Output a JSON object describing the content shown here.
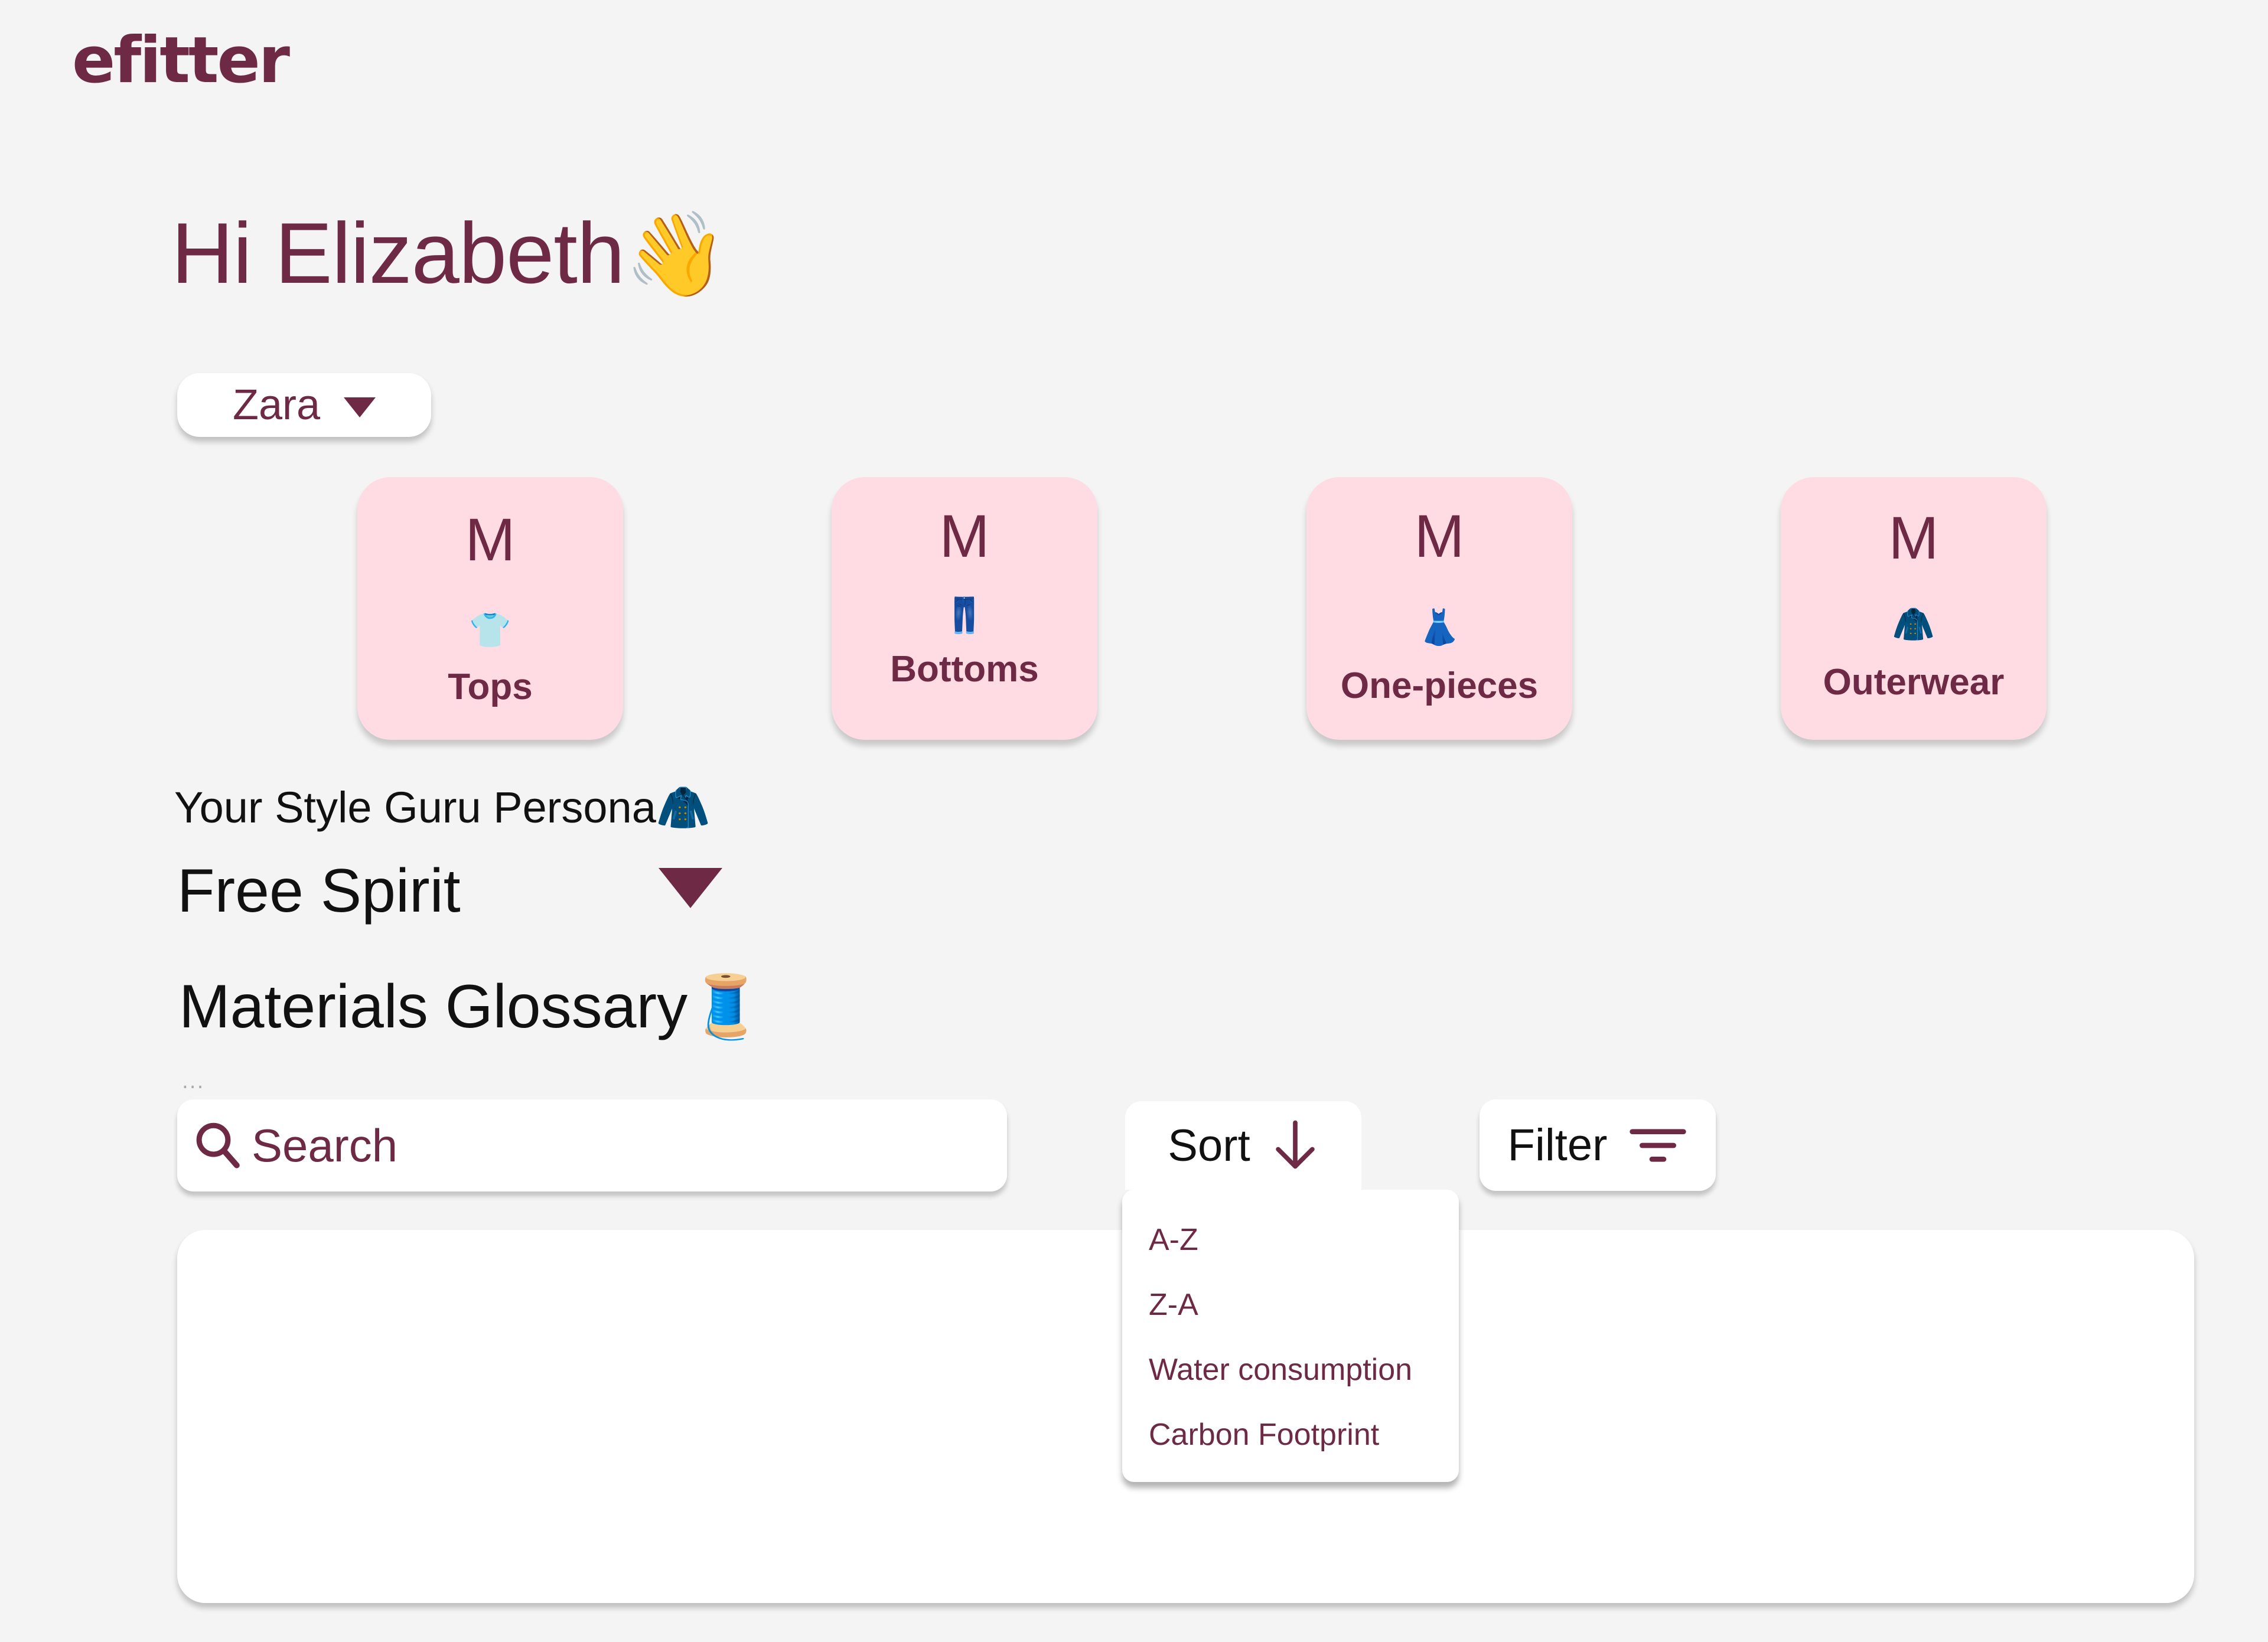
{
  "app": {
    "logo": "efitter"
  },
  "greeting": {
    "text": "Hi Elizabeth",
    "emoji": "👋"
  },
  "brand_selector": {
    "value": "Zara",
    "icon": "caret-down-icon"
  },
  "size_cards": [
    {
      "size": "M",
      "emoji": "👕",
      "icon": "shirt-icon",
      "label": "Tops"
    },
    {
      "size": "M",
      "emoji": "👖",
      "icon": "jeans-icon",
      "label": "Bottoms"
    },
    {
      "size": "M",
      "emoji": "👗",
      "icon": "dress-icon",
      "label": "One-pieces"
    },
    {
      "size": "M",
      "emoji": "🧥",
      "icon": "coat-icon",
      "label": "Outerwear"
    }
  ],
  "persona": {
    "label": "Your Style Guru Persona",
    "label_emoji": "🧥",
    "value": "Free Spirit",
    "icon": "caret-down-icon"
  },
  "glossary": {
    "title": "Materials Glossary",
    "title_emoji": "🧵",
    "more": "...",
    "search": {
      "placeholder": "Search",
      "value": "",
      "icon": "search-icon"
    },
    "sort": {
      "label": "Sort",
      "icon": "arrow-down-icon"
    },
    "filter": {
      "label": "Filter",
      "icon": "filter-lines-icon"
    },
    "sort_options": [
      "A-Z",
      "Z-A",
      "Water consumption",
      "Carbon Footprint"
    ]
  },
  "colors": {
    "accent": "#6e2a45",
    "card_bg": "#ffdbe3",
    "page_bg": "#f4f4f4"
  }
}
